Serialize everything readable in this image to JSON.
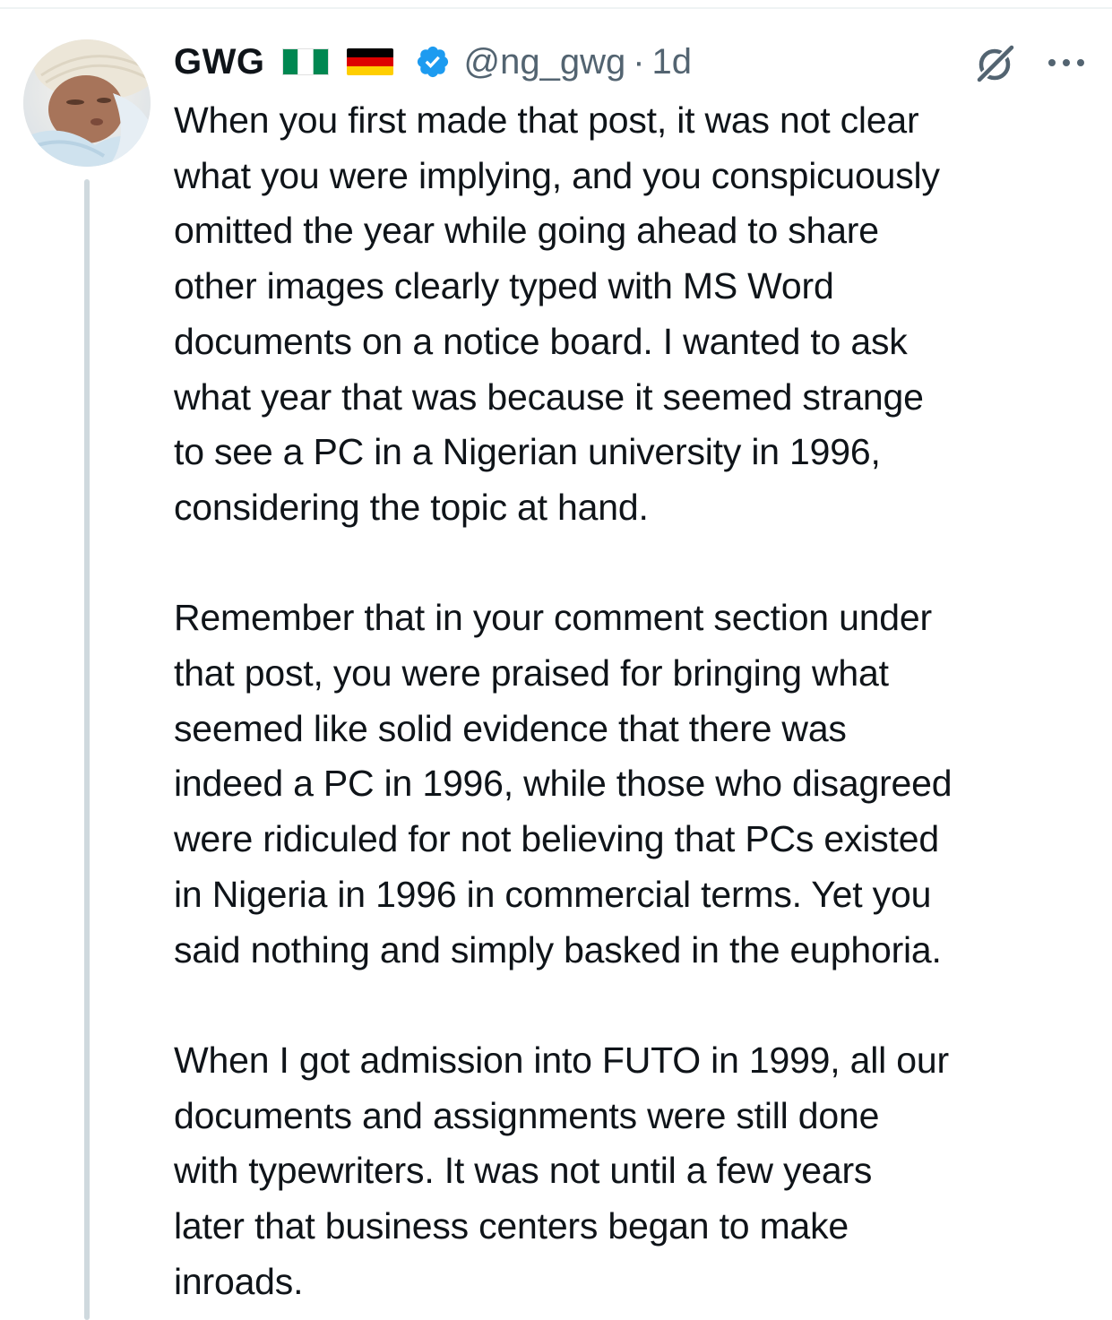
{
  "tweet": {
    "author": {
      "display_name": "GWG",
      "flags": [
        "nigeria-flag",
        "germany-flag"
      ],
      "verified": true,
      "handle": "@ng_gwg",
      "separator": "·",
      "time": "1d"
    },
    "icons": [
      "grok-icon",
      "more-icon"
    ],
    "paragraphs": [
      {
        "lines": [
          "When you first made that post, it was not clear",
          "what you were implying, and you conspicuously",
          "omitted the year while going ahead to share",
          "other images clearly typed with MS Word",
          "documents on a notice board. I wanted to ask",
          "what year that was because it seemed strange",
          "to see a PC in a Nigerian university in 1996,",
          "considering the topic at hand."
        ]
      },
      {
        "lines": [
          "Remember that in your comment section under",
          "that post, you were praised for bringing what",
          "seemed like solid evidence that there was",
          "indeed a PC in 1996, while those who disagreed",
          "were ridiculed for not believing that PCs existed",
          "in Nigeria in 1996 in commercial terms. Yet you",
          "said nothing and simply basked in the euphoria."
        ]
      },
      {
        "lines": [
          "When I got admission into FUTO in 1999, all our",
          "documents and assignments were still done",
          "with typewriters. It was not until a few years",
          "later that business centers began to make",
          "inroads."
        ]
      }
    ]
  },
  "colors": {
    "text_primary": "#0f1419",
    "text_secondary": "#536471",
    "verified_blue": "#1d9bf0",
    "thread_line": "#cfd9de"
  }
}
